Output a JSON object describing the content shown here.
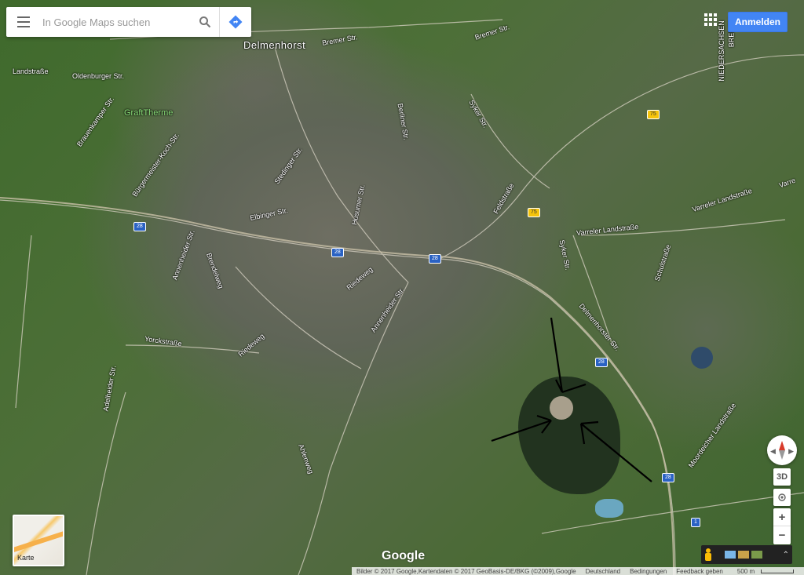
{
  "search": {
    "placeholder": "In Google Maps suchen"
  },
  "header": {
    "signin_label": "Anmelden"
  },
  "map": {
    "labels": {
      "delmenhorst": "Delmenhorst",
      "bremer_str": "Bremer Str.",
      "oldenburger_str": "Oldenburger Str.",
      "landstrasse": "Landstraße",
      "graftherme": "GraftTherme",
      "syker_str_top": "Syker Str.",
      "berliner_str": "Berliner Str.",
      "elbinger_str": "Elbinger Str.",
      "husumer_str": "Husumer Str.",
      "brauenkamper": "Brauenkamper Str.",
      "buerger": "Bürgermeister-Koch-Str.",
      "stedinger": "Stedinger Str.",
      "feldstrasse": "Feldstraße",
      "varreler1": "Varreler Landstraße",
      "varreler2": "Varreler Landstraße",
      "syker_str_mid": "Syker Str.",
      "delmenhorster": "Delmenhorster Str.",
      "schulstrasse": "Schulstraße",
      "riedeweg": "Riedeweg",
      "riedeweg2": "Riedeweg",
      "annenheider": "Annenheider Str.",
      "annenheider2": "Annenheider Str.",
      "brendelweg": "Brendelweg",
      "yorckstrasse": "Yorckstraße",
      "ahlenweg": "Ahlenweg",
      "moordeicher": "Moordeicher Landstraße",
      "adelheider": "Adelheider Str.",
      "niedersachsen": "NIEDERSACHSEN",
      "varre": "Varre",
      "bremen": "BREMEN"
    },
    "shields": [
      "28",
      "28",
      "28",
      "75",
      "75",
      "28",
      "28",
      "1"
    ]
  },
  "controls": {
    "maptype_label": "Karte",
    "three_d": "3D",
    "zoom_in": "+",
    "zoom_out": "−",
    "compass_left": "◀",
    "compass_right": "▶",
    "expand": "⌃"
  },
  "logo": "Google",
  "footer": {
    "copyright": "Bilder © 2017 Google,Kartendaten © 2017 GeoBasis-DE/BKG (©2009),Google",
    "country": "Deutschland",
    "terms": "Bedingungen",
    "feedback": "Feedback geben",
    "scale": "500 m"
  },
  "colors": {
    "accent": "#4285f4",
    "route_shield": "#2a62c4",
    "highway_shield": "#f6c40b"
  },
  "icons": {
    "menu": "hamburger-icon",
    "search": "search-icon",
    "directions": "directions-icon",
    "apps": "apps-grid-icon",
    "pegman": "pegman-icon",
    "compass": "compass-icon"
  }
}
